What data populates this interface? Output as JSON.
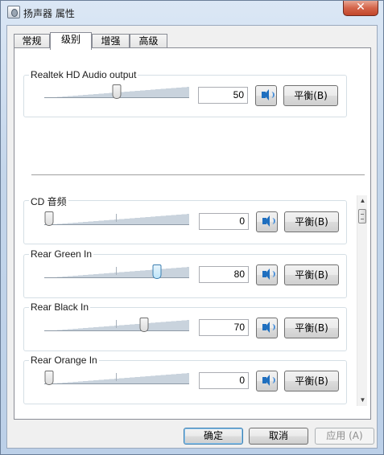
{
  "window": {
    "title": "扬声器 属性",
    "close_label": "✕"
  },
  "tabs": [
    {
      "label": "常规",
      "active": false
    },
    {
      "label": "级别",
      "active": true
    },
    {
      "label": "增强",
      "active": false
    },
    {
      "label": "高级",
      "active": false
    }
  ],
  "master": {
    "label": "Realtek HD Audio output",
    "value": "50",
    "level_percent": 50,
    "balance_label": "平衡(B)"
  },
  "channels": [
    {
      "label": "CD 音频",
      "value": "0",
      "level_percent": 0,
      "balance_label": "平衡(B)",
      "hot": false
    },
    {
      "label": "Rear Green In",
      "value": "80",
      "level_percent": 80,
      "balance_label": "平衡(B)",
      "hot": true
    },
    {
      "label": "Rear Black In",
      "value": "70",
      "level_percent": 70,
      "balance_label": "平衡(B)",
      "hot": false
    },
    {
      "label": "Rear Orange In",
      "value": "0",
      "level_percent": 0,
      "balance_label": "平衡(B)",
      "hot": false
    }
  ],
  "scrollbar": {
    "up_arrow": "▲",
    "down_arrow": "▼"
  },
  "buttons": {
    "ok": "确定",
    "cancel": "取消",
    "apply": "应用 (A)"
  },
  "colors": {
    "accent": "#3c7fb1",
    "speaker": "#1f6fbf",
    "close": "#c2462a"
  }
}
